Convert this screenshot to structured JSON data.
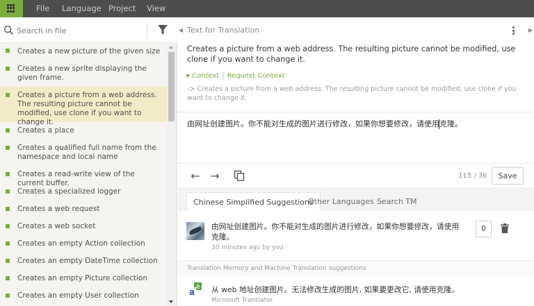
{
  "menu": [
    "File",
    "Language",
    "Project",
    "View"
  ],
  "search": {
    "placeholder": "Search in file"
  },
  "strings": [
    "Creates a new picture of the given size",
    "Creates a new sprite displaying the given frame.",
    "Creates a picture from a web address. The resulting picture cannot be modified, use clone if you want to change it.",
    "Creates a place",
    "Creates a qualified full name from the namespace and local name",
    "Creates a read-write view of the current buffer.",
    "Creates a specialized logger",
    "Creates a web request",
    "Creates a web socket",
    "Creates an empty Action collection",
    "Creates an empty DateTime collection",
    "Creates an empty Picture collection",
    "Creates an empty User collection"
  ],
  "source": {
    "header": "Text for Translation",
    "text": "Creates a picture from a web address. The resulting picture cannot be modified, use clone if you want to change it.",
    "context_label": "Context",
    "request_context_label": "Request Context",
    "context_text": "-> Creates a picture from a web address. The resulting picture cannot be modified, use clone if you want to change it."
  },
  "translation": {
    "value": "由网址创建图片。你不能对生成的图片进行修改，如果你想要修改，请使用克隆。",
    "counter": "115 / 36",
    "save_label": "Save"
  },
  "tabs": [
    "Chinese Simplified Suggestions",
    "Other Languages",
    "Search TM"
  ],
  "suggestion": {
    "text": "由网址创建图片。你不能对生成的图片进行修改，如果你想要修改，请使用克隆。",
    "meta": "30 minutes ago by you",
    "votes": "0"
  },
  "tm": {
    "header": "Translation Memory and Machine Translation suggestions",
    "text": "从 web 地址创建图片。无法修改生成的图片, 如果要更改它, 请使用克隆。",
    "source": "Microsoft Translator"
  },
  "colors": {
    "accent": "#7bac3e",
    "topbar": "#4d4d4d",
    "selected": "#f3ebc8"
  }
}
